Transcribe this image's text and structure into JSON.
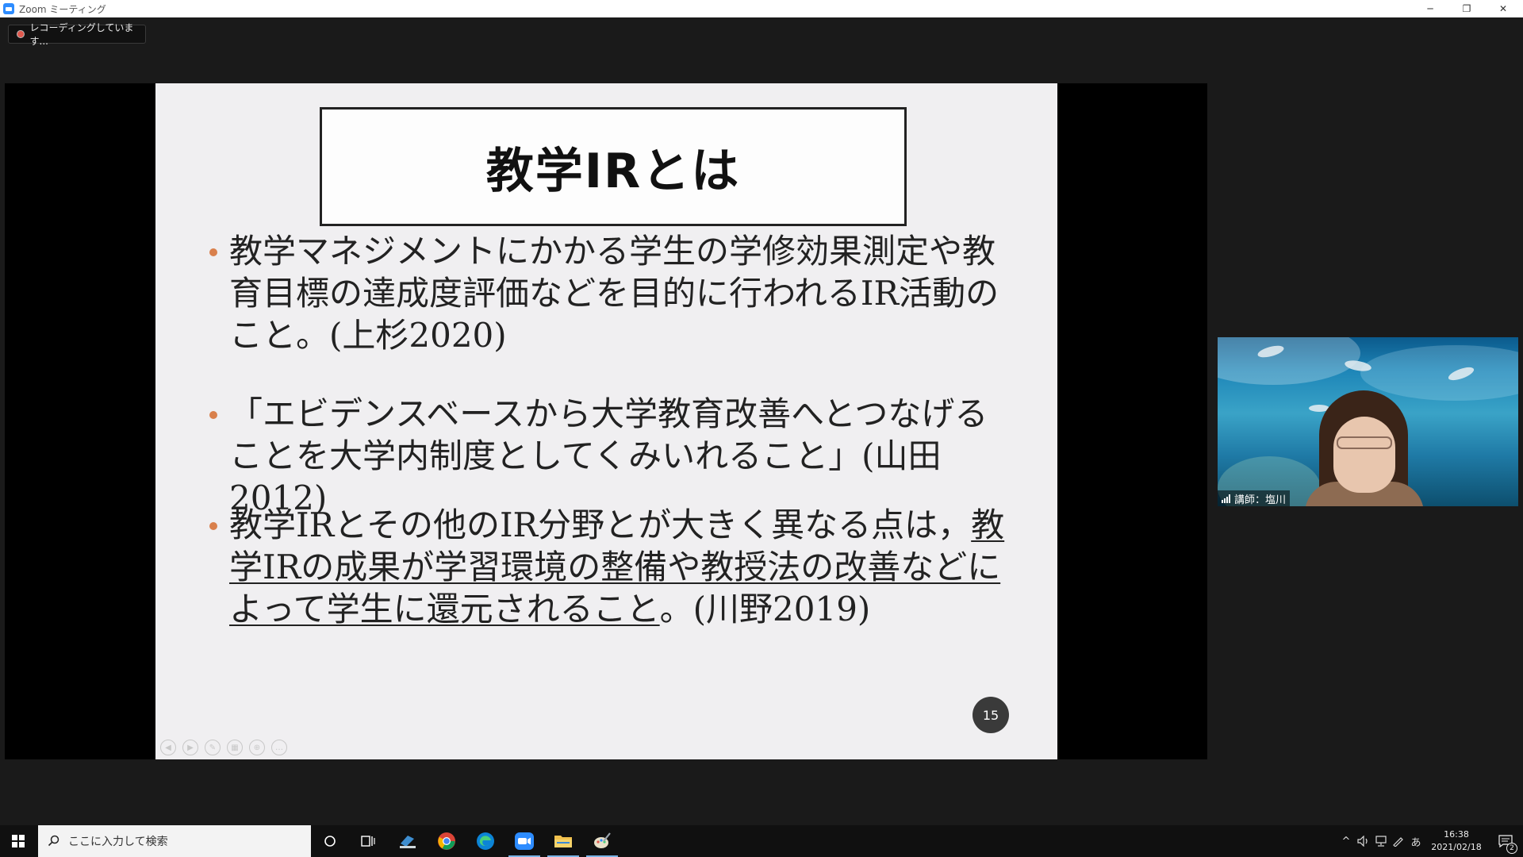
{
  "window": {
    "title": "Zoom ミーティング",
    "minimize_glyph": "─",
    "restore_glyph": "❐",
    "close_glyph": "✕"
  },
  "recording": {
    "label": "レコーディングしています..."
  },
  "slide": {
    "title": "教学IRとは",
    "bullets": [
      {
        "text": "教学マネジメントにかかる学生の学修効果測定や教育目標の達成度評価などを目的に行われるIR活動のこと。(上杉2020)"
      },
      {
        "text": "「エビデンスベースから大学教育改善へとつなげることを大学内制度としてくみいれること」(山田2012)"
      },
      {
        "text_prefix": "教学IRとその他のIR分野とが大きく異なる点は，",
        "text_underlined": "教学IRの成果が学習環境の整備や教授法の改善などによって学生に還元されること",
        "text_suffix": "。(川野2019)"
      }
    ],
    "page_number": "15",
    "bullet_color": "#d9804c"
  },
  "video": {
    "participant_name": "講師：塩川"
  },
  "taskbar": {
    "search_placeholder": "ここに入力して検索",
    "clock_time": "16:38",
    "clock_date": "2021/02/18",
    "ime_indicator": "あ",
    "notification_count": "2",
    "apps": [
      "chrome-icon",
      "edge-icon",
      "zoom-icon",
      "file-explorer-icon",
      "paint-icon"
    ]
  },
  "colors": {
    "zoom_blue": "#2d8cff",
    "recording_red": "#e0594e"
  }
}
